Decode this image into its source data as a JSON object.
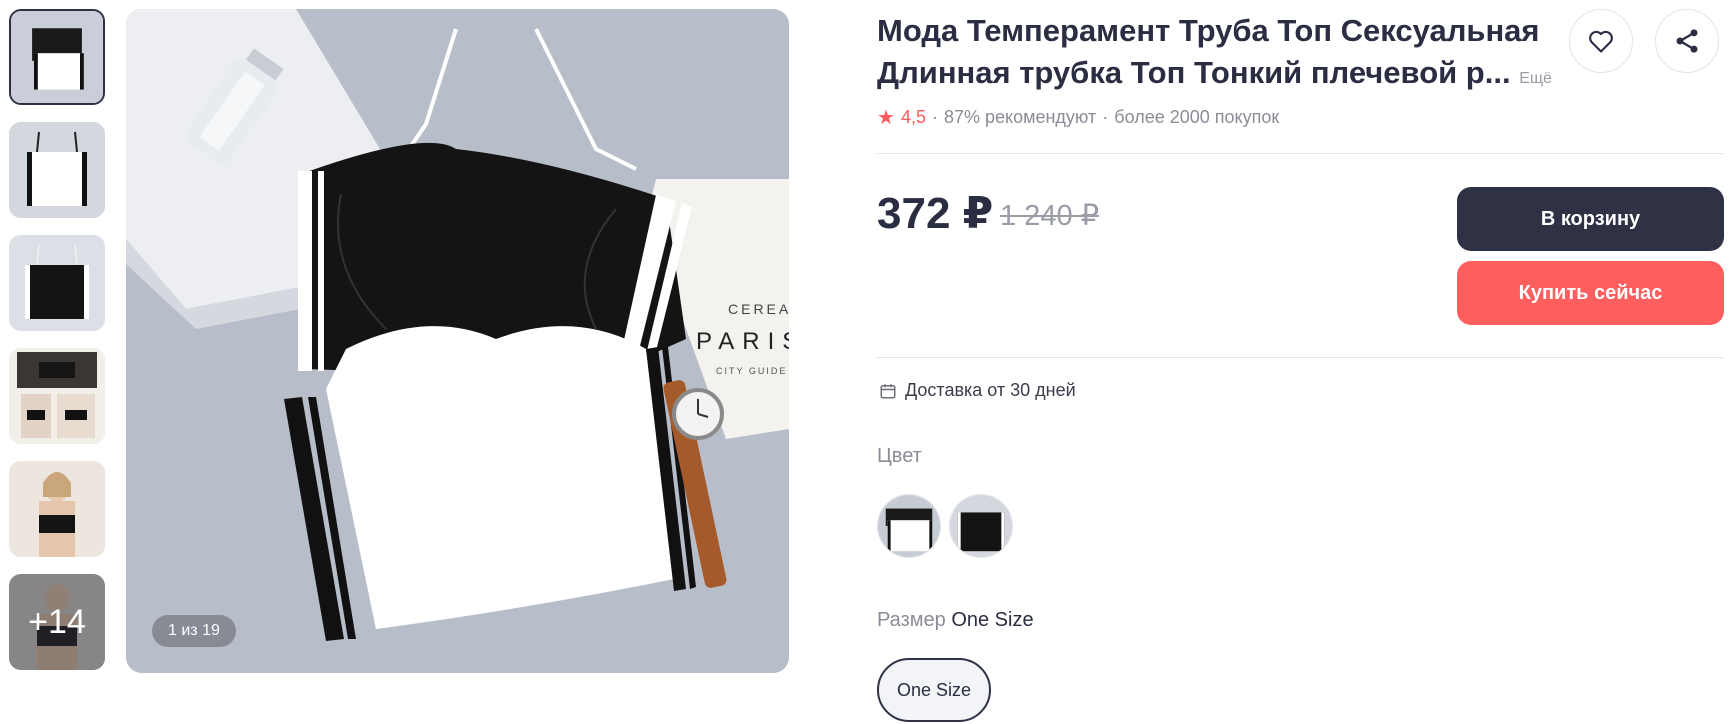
{
  "product": {
    "title": "Мода Темперамент Труба Топ Сексуальная Длинная трубка Топ Тонкий плечевой р...",
    "more_link": "Ещё",
    "rating": "4,5",
    "recommend": "87% рекомендуют",
    "purchases": "более 2000 покупок",
    "price": "372 ₽",
    "old_price": "1 240 ₽"
  },
  "actions": {
    "cart_label": "В корзину",
    "buy_label": "Купить сейчас",
    "favorite_icon": "heart-icon",
    "share_icon": "share-icon"
  },
  "delivery": {
    "icon": "calendar-icon",
    "text": "Доставка от 30 дней"
  },
  "color": {
    "label": "Цвет"
  },
  "size": {
    "label": "Размер",
    "selected": "One Size",
    "options": [
      "One Size"
    ]
  },
  "gallery": {
    "counter": "1 из 19",
    "more_count": "+14",
    "main_text_cereal": "CEREAL",
    "main_text_paris": "PARIS",
    "main_text_guide": "CITY GUIDE"
  },
  "colors": {
    "accent_dark": "#2f3145",
    "accent_red": "#ff5e5e",
    "star": "#ff5a5f"
  }
}
